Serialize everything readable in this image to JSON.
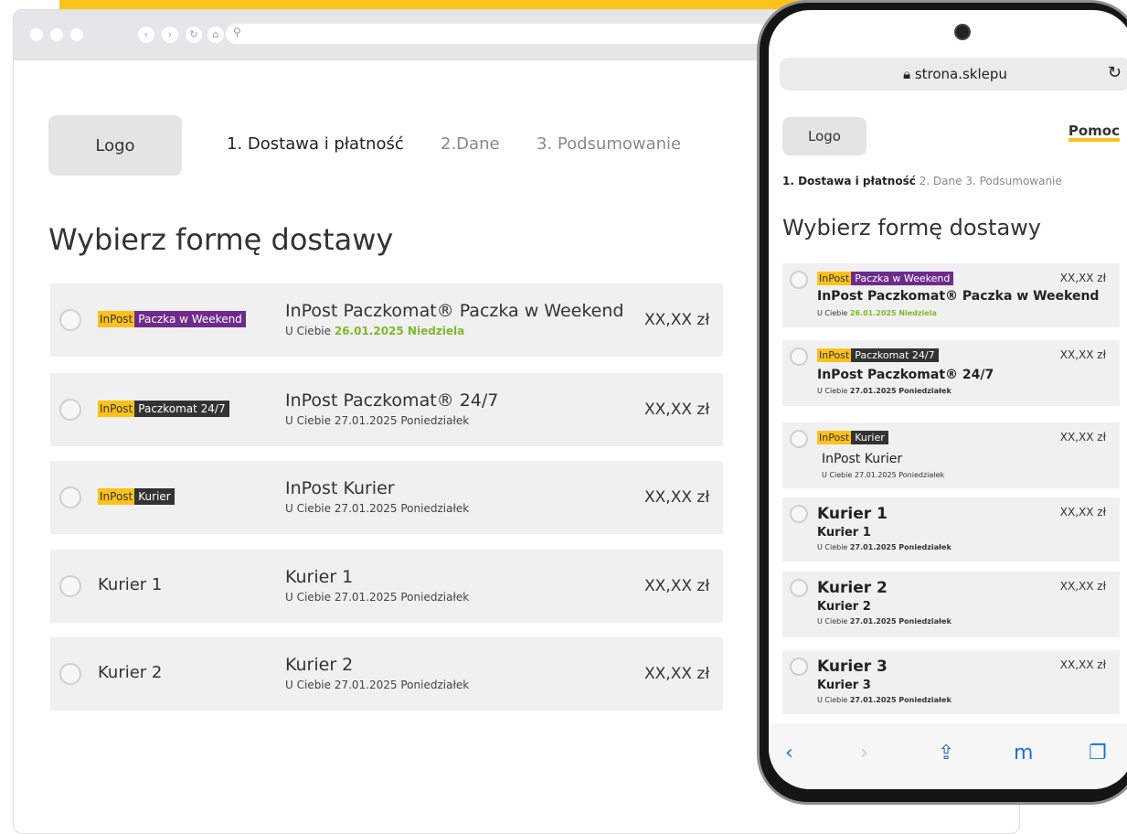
{
  "desktop": {
    "logo": "Logo",
    "steps": [
      "1. Dostawa i płatność",
      "2.Dane",
      "3. Podsumowanie"
    ],
    "title": "Wybierz formę dostawy",
    "options": [
      {
        "tag_y": "InPost",
        "tag_x": "Paczka w Weekend",
        "name": "InPost Paczkomat® Paczka w Weekend",
        "sub_prefix": "U Ciebie ",
        "sub_date": "26.01.2025 Niedziela",
        "price": "XX,XX zł"
      },
      {
        "tag_y": "InPost",
        "tag_x": "Paczkomat 24/7",
        "name": "InPost Paczkomat® 24/7",
        "sub": "U Ciebie 27.01.2025 Poniedziałek",
        "price": "XX,XX zł"
      },
      {
        "tag_y": "InPost",
        "tag_x": "Kurier",
        "name": "InPost Kurier",
        "sub": "U Ciebie 27.01.2025 Poniedziałek",
        "price": "XX,XX zł"
      },
      {
        "label": "Kurier 1",
        "name": "Kurier 1",
        "sub": "U Ciebie 27.01.2025 Poniedziałek",
        "price": "XX,XX zł"
      },
      {
        "label": "Kurier 2",
        "name": "Kurier 2",
        "sub": "U Ciebie 27.01.2025 Poniedziałek",
        "price": "XX,XX zł"
      }
    ]
  },
  "mobile": {
    "url": "strona.sklepu",
    "logo": "Logo",
    "help": "Pomoc",
    "step1": "1. Dostawa i płatność",
    "step2": "2. Dane",
    "step3": "3. Podsumowanie",
    "title": "Wybierz formę dostawy",
    "options": [
      {
        "tag_y": "InPost",
        "tag_x": "Paczka w Weekend",
        "name": "InPost Paczkomat® Paczka w Weekend",
        "sub_prefix": "U Ciebie ",
        "sub_date": "26.01.2025 Niedziela",
        "price": "XX,XX zł"
      },
      {
        "tag_y": "InPost",
        "tag_x": "Paczkomat 24/7",
        "name": "InPost Paczkomat® 24/7",
        "sub_prefix": "U Ciebie ",
        "sub_date": "27.01.2025 Poniedziałek",
        "price": "XX,XX zł"
      },
      {
        "tag_y": "InPost",
        "tag_x": "Kurier",
        "name": "InPost Kurier",
        "sub": "U Ciebie 27.01.2025 Poniedziałek",
        "price": "XX,XX zł"
      },
      {
        "label": "Kurier 1",
        "name": "Kurier 1",
        "sub_prefix": "U Ciebie ",
        "sub_date": "27.01.2025 Poniedziałek",
        "price": "XX,XX zł"
      },
      {
        "label": "Kurier 2",
        "name": "Kurier 2",
        "sub_prefix": "U Ciebie ",
        "sub_date": "27.01.2025 Poniedziałek",
        "price": "XX,XX zł"
      },
      {
        "label": "Kurier 3",
        "name": "Kurier 3",
        "sub_prefix": "U Ciebie ",
        "sub_date": "27.01.2025 Poniedziałek",
        "price": "XX,XX zł"
      }
    ]
  },
  "colors": {
    "accent": "#fcc21b",
    "inpost_purple": "#6e2b8c",
    "date_green": "#7fb72a",
    "option_bg": "#f0f0f0"
  }
}
